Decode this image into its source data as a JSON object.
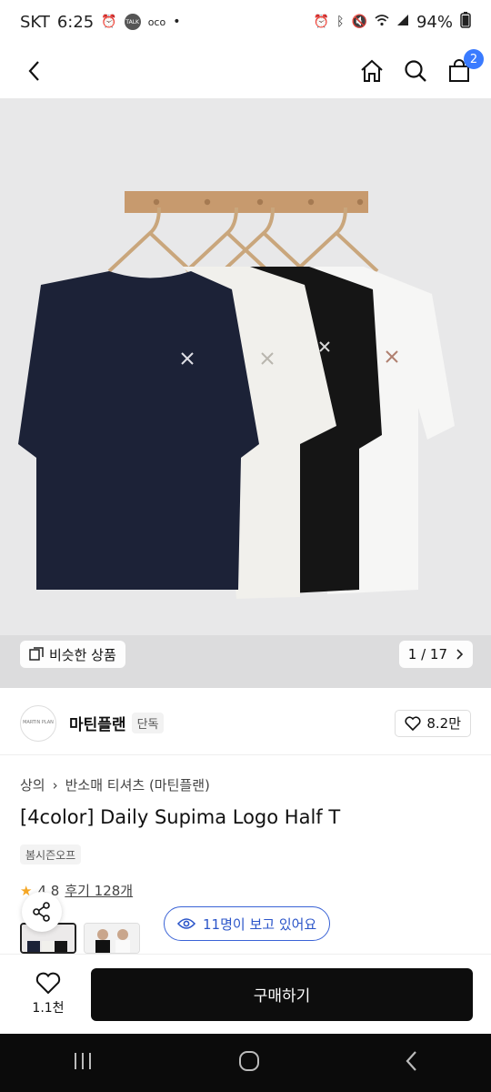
{
  "status": {
    "carrier": "SKT",
    "time": "6:25",
    "battery": "94%",
    "left_icons": [
      "alarm-icon",
      "kakaotalk-icon",
      "oco-icon",
      "dot-icon"
    ],
    "right_icons": [
      "alarm-icon",
      "bluetooth-icon",
      "mute-icon",
      "wifi-icon",
      "signal-icon",
      "battery-icon"
    ],
    "talk": "TALK",
    "oco": "oco"
  },
  "topbar": {
    "cart_count": "2"
  },
  "hero": {
    "similar_label": "비슷한 상품",
    "counter": "1 / 17",
    "shirt_colors": [
      "#1c2237",
      "#f1f0ec",
      "#151515",
      "#f6f6f5"
    ]
  },
  "store": {
    "logo_text": "MARTIN PLAN",
    "name": "마틴플랜",
    "tag": "단독",
    "likes": "8.2만"
  },
  "product": {
    "breadcrumb": [
      "상의",
      "반소매 티셔츠 (마틴플랜)"
    ],
    "title": "[4color] Daily Supima Logo Half T",
    "season_chip": "봄시즌오프",
    "rating": "4.8",
    "reviews": "후기 128개"
  },
  "viewers": {
    "text": "11명이 보고 있어요"
  },
  "bottom": {
    "wish_count": "1.1천",
    "buy_label": "구매하기"
  },
  "colors": {
    "accent": "#3a7bff",
    "viewer_blue": "#2b55c9",
    "buy_bg": "#0d0d0d"
  }
}
